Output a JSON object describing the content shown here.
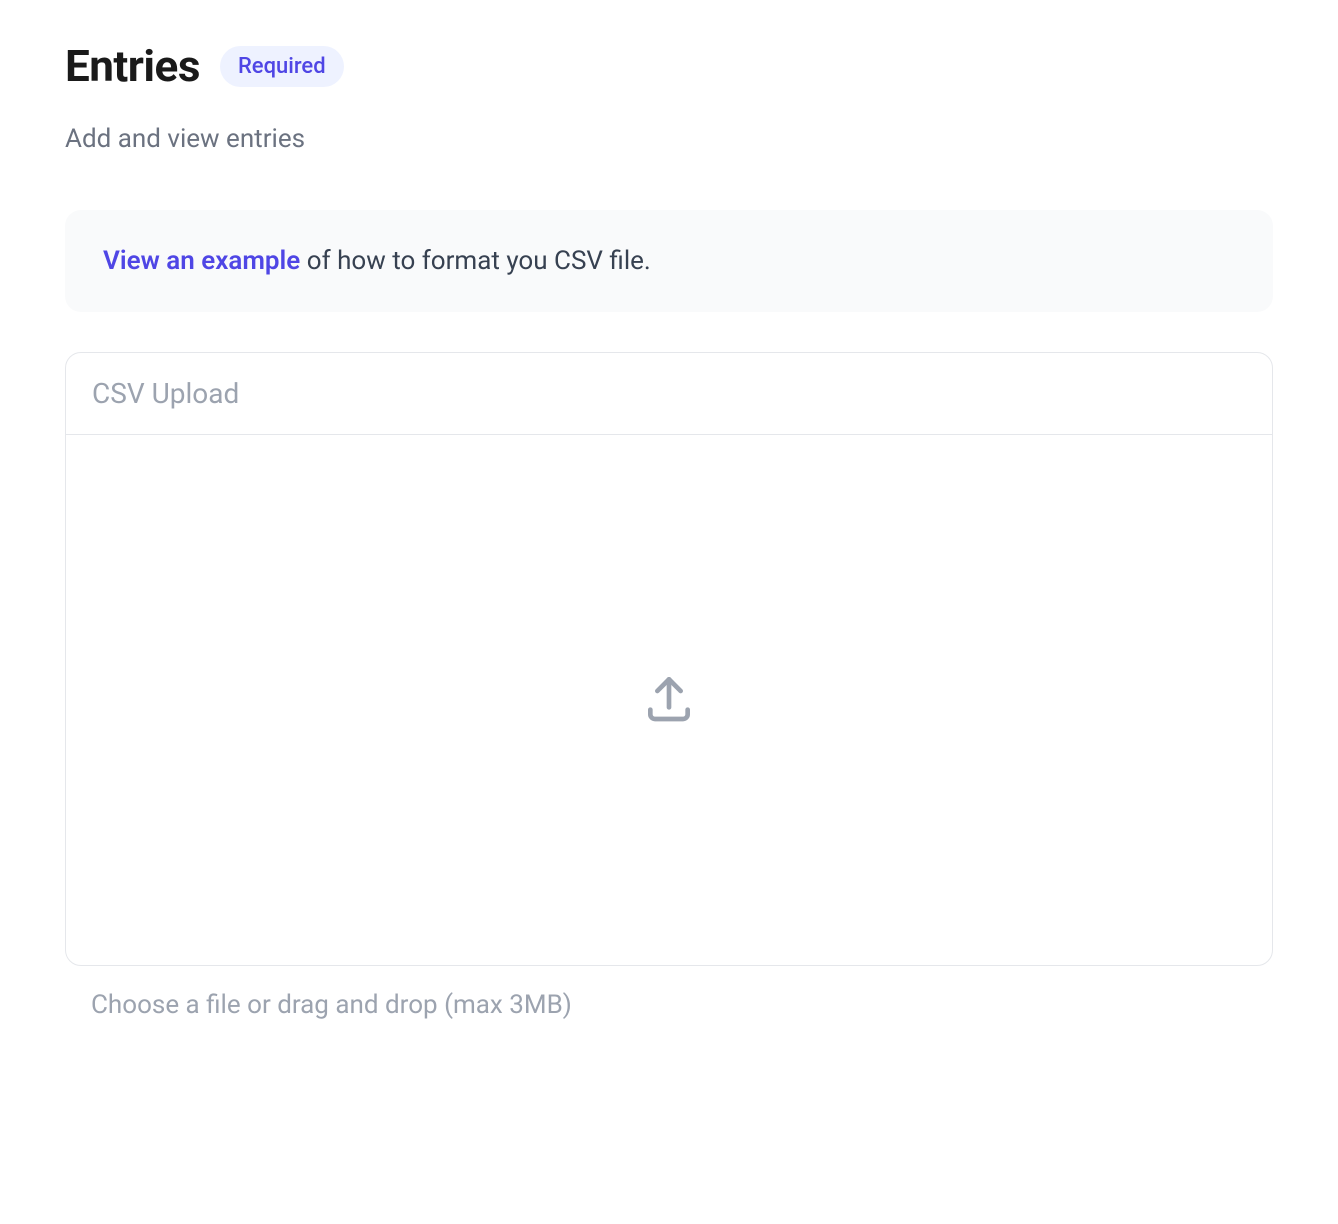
{
  "header": {
    "title": "Entries",
    "badge": "Required",
    "subtitle": "Add and view entries"
  },
  "banner": {
    "link_text": "View an example",
    "rest_text": " of how to format you CSV file."
  },
  "upload": {
    "section_title": "CSV Upload",
    "helper_text": "Choose a file or drag and drop (max 3MB)"
  }
}
